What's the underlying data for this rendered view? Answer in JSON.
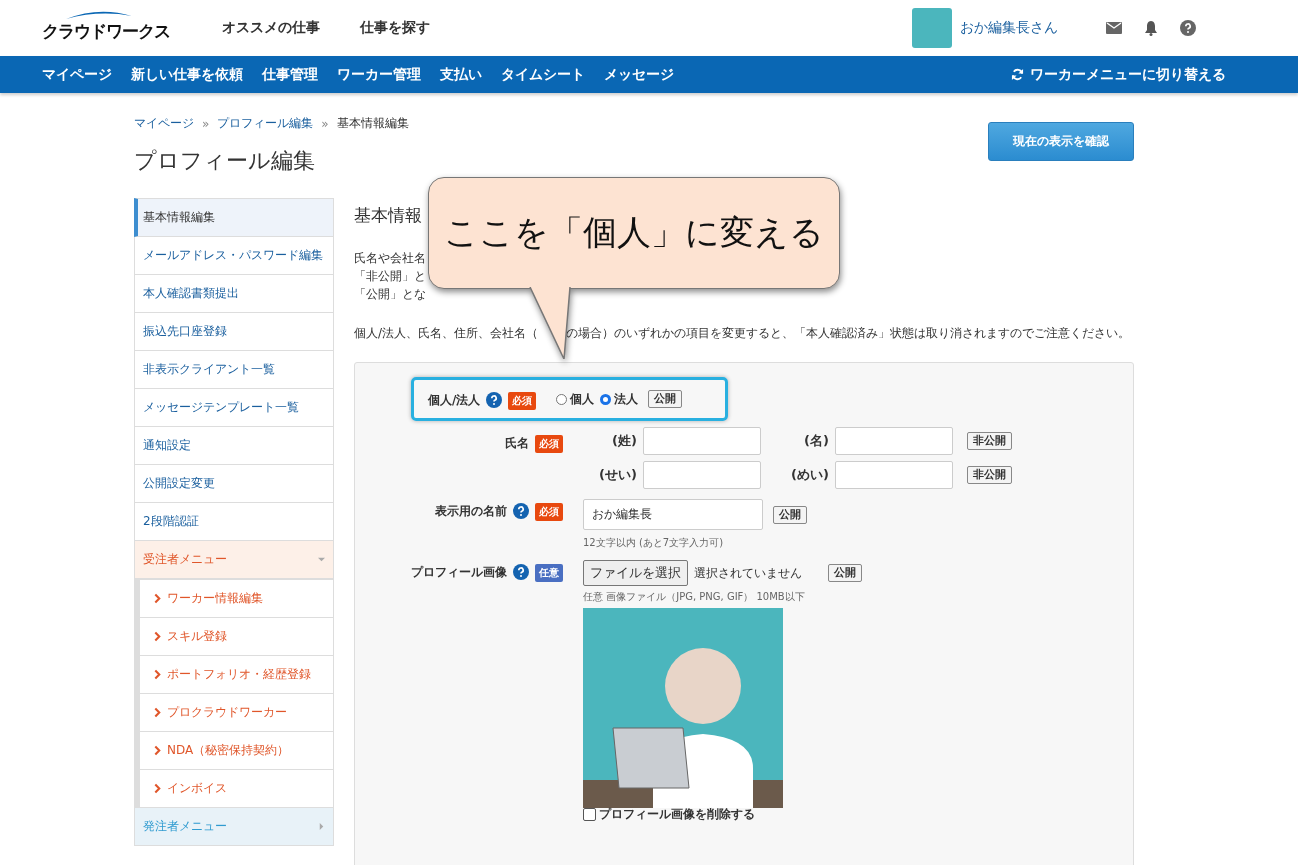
{
  "header": {
    "logo": "クラウドワークス",
    "top_links": [
      "オススメの仕事",
      "仕事を探す"
    ],
    "user_name": "おか編集長さん"
  },
  "nav": {
    "items": [
      "マイページ",
      "新しい仕事を依頼",
      "仕事管理",
      "ワーカー管理",
      "支払い",
      "タイムシート",
      "メッセージ"
    ],
    "switch_link": "ワーカーメニューに切り替える"
  },
  "breadcrumb": {
    "items": [
      "マイページ",
      "プロフィール編集",
      "基本情報編集"
    ],
    "separator": "»"
  },
  "page_title": "プロフィール編集",
  "confirm_button": "現在の表示を確認",
  "sidebar": {
    "items": [
      {
        "kind": "item",
        "label": "基本情報編集",
        "selected": true
      },
      {
        "kind": "item",
        "label": "メールアドレス・パスワード編集",
        "selected": false
      },
      {
        "kind": "item",
        "label": "本人確認書類提出",
        "selected": false
      },
      {
        "kind": "item",
        "label": "振込先口座登録",
        "selected": false
      },
      {
        "kind": "item",
        "label": "非表示クライアント一覧",
        "selected": false
      },
      {
        "kind": "item",
        "label": "メッセージテンプレート一覧",
        "selected": false
      },
      {
        "kind": "item",
        "label": "通知設定",
        "selected": false
      },
      {
        "kind": "item",
        "label": "公開設定変更",
        "selected": false
      },
      {
        "kind": "item",
        "label": "2段階認証",
        "selected": false
      },
      {
        "kind": "group",
        "label": "受注者メニュー",
        "expanded": true,
        "children": [
          {
            "label": "ワーカー情報編集"
          },
          {
            "label": "スキル登録"
          },
          {
            "label": "ポートフォリオ・経歴登録"
          },
          {
            "label": "プロクラウドワーカー"
          },
          {
            "label": "NDA（秘密保持契約）"
          },
          {
            "label": "インボイス"
          }
        ]
      },
      {
        "kind": "group",
        "label": "発注者メニュー",
        "expanded": false
      }
    ]
  },
  "main": {
    "section_title": "基本情報",
    "notes": [
      "氏名や会社名",
      "「非公開」と",
      "「公開」とな"
    ],
    "warning_parts": [
      "個人/法人、氏名、住所、会社名（",
      "の場合）のいずれかの項目を変更すると、「本人確認済み」状態は取り消されますのでご注意ください。"
    ]
  },
  "form": {
    "rows": [
      {
        "kind": "radio",
        "label": "個人/法人",
        "help": true,
        "badge": {
          "text": "必須",
          "kind": "required"
        },
        "highlighted": true,
        "options": [
          {
            "label": "個人",
            "selected": false
          },
          {
            "label": "法人",
            "selected": true
          }
        ],
        "visibility": "公開"
      },
      {
        "kind": "name",
        "label": "氏名",
        "help": false,
        "badge": {
          "text": "必須",
          "kind": "required"
        },
        "highlighted": false,
        "lines": [
          {
            "fields": [
              "(姓)",
              "(名)"
            ],
            "visibility": "非公開"
          },
          {
            "fields": [
              "(せい)",
              "(めい)"
            ],
            "visibility": "非公開"
          }
        ]
      },
      {
        "kind": "text",
        "label": "表示用の名前",
        "help": true,
        "badge": {
          "text": "必須",
          "kind": "required"
        },
        "highlighted": false,
        "value": "おか編集長",
        "visibility": "公開",
        "hint": "12文字以内 (あと7文字入力可)"
      },
      {
        "kind": "file",
        "label": "プロフィール画像",
        "help": true,
        "badge": {
          "text": "任意",
          "kind": "optional"
        },
        "highlighted": false,
        "button": "ファイルを選択",
        "status": "選択されていません",
        "visibility": "公開",
        "hint": "任意 画像ファイル（JPG, PNG, GIF） 10MB以下",
        "delete": {
          "label": "プロフィール画像を削除する",
          "checked": false
        }
      }
    ]
  },
  "callout": {
    "text": "ここを「個人」に変える"
  }
}
